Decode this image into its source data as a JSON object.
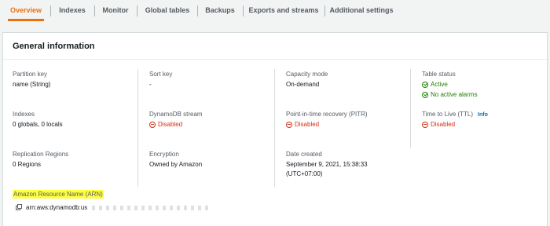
{
  "tabs": [
    "Overview",
    "Indexes",
    "Monitor",
    "Global tables",
    "Backups",
    "Exports and streams",
    "Additional settings"
  ],
  "panel": {
    "title": "General information"
  },
  "fields": {
    "partition_key": {
      "label": "Partition key",
      "value": "name (String)"
    },
    "sort_key": {
      "label": "Sort key",
      "value": "-"
    },
    "capacity_mode": {
      "label": "Capacity mode",
      "value": "On-demand"
    },
    "table_status": {
      "label": "Table status",
      "value": "Active",
      "alarms": "No active alarms"
    },
    "indexes": {
      "label": "Indexes",
      "value": "0 globals, 0 locals"
    },
    "dynamodb_stream": {
      "label": "DynamoDB stream",
      "value": "Disabled"
    },
    "pitr": {
      "label": "Point-in-time recovery (PITR)",
      "value": "Disabled"
    },
    "ttl": {
      "label": "Time to Live (TTL)",
      "info": "Info",
      "value": "Disabled"
    },
    "replication": {
      "label": "Replication Regions",
      "value": "0 Regions"
    },
    "encryption": {
      "label": "Encryption",
      "value": "Owned by Amazon"
    },
    "date_created": {
      "label": "Date created",
      "value_line1": "September 9, 2021, 15:38:33",
      "value_line2": "(UTC+07:00)"
    },
    "arn": {
      "label": "Amazon Resource Name (ARN)",
      "value": "arn:aws:dynamodb:us"
    }
  },
  "colors": {
    "accent": "#ec7211",
    "success": "#1d8102",
    "error": "#d13212",
    "highlight": "#ffff40",
    "link": "#0073bb"
  },
  "icons": {
    "ok": "check-circle-icon",
    "disabled": "minus-circle-icon",
    "copy": "copy-icon"
  }
}
